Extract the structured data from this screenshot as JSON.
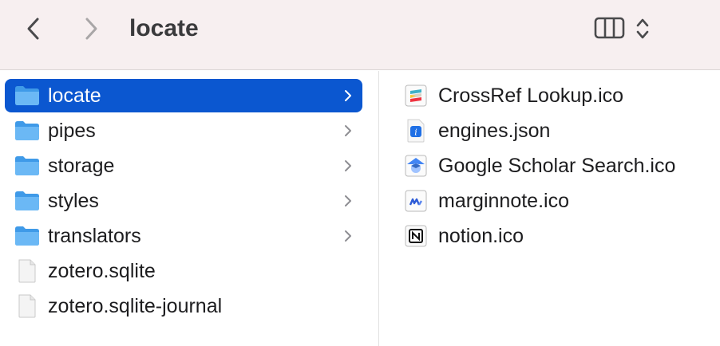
{
  "window": {
    "title": "locate"
  },
  "toolbar": {
    "back_icon": "chevron-left-icon",
    "forward_icon": "chevron-right-icon",
    "view_icon": "column-view-icon",
    "view_options_icon": "chevron-updown-icon"
  },
  "colors": {
    "toolbar_bg": "#f7eff0",
    "selection": "#0b57d0",
    "folder": "#5ab0f0"
  },
  "left_column": {
    "items": [
      {
        "label": "locate",
        "type": "folder",
        "selected": true
      },
      {
        "label": "pipes",
        "type": "folder"
      },
      {
        "label": "storage",
        "type": "folder"
      },
      {
        "label": "styles",
        "type": "folder"
      },
      {
        "label": "translators",
        "type": "folder"
      },
      {
        "label": "zotero.sqlite",
        "type": "file"
      },
      {
        "label": "zotero.sqlite-journal",
        "type": "file"
      }
    ]
  },
  "right_column": {
    "items": [
      {
        "label": "CrossRef Lookup.ico",
        "icon": "crossref-icon"
      },
      {
        "label": "engines.json",
        "icon": "json-file-icon"
      },
      {
        "label": "Google Scholar Search.ico",
        "icon": "google-scholar-icon"
      },
      {
        "label": "marginnote.ico",
        "icon": "marginnote-icon"
      },
      {
        "label": "notion.ico",
        "icon": "notion-icon"
      }
    ]
  }
}
